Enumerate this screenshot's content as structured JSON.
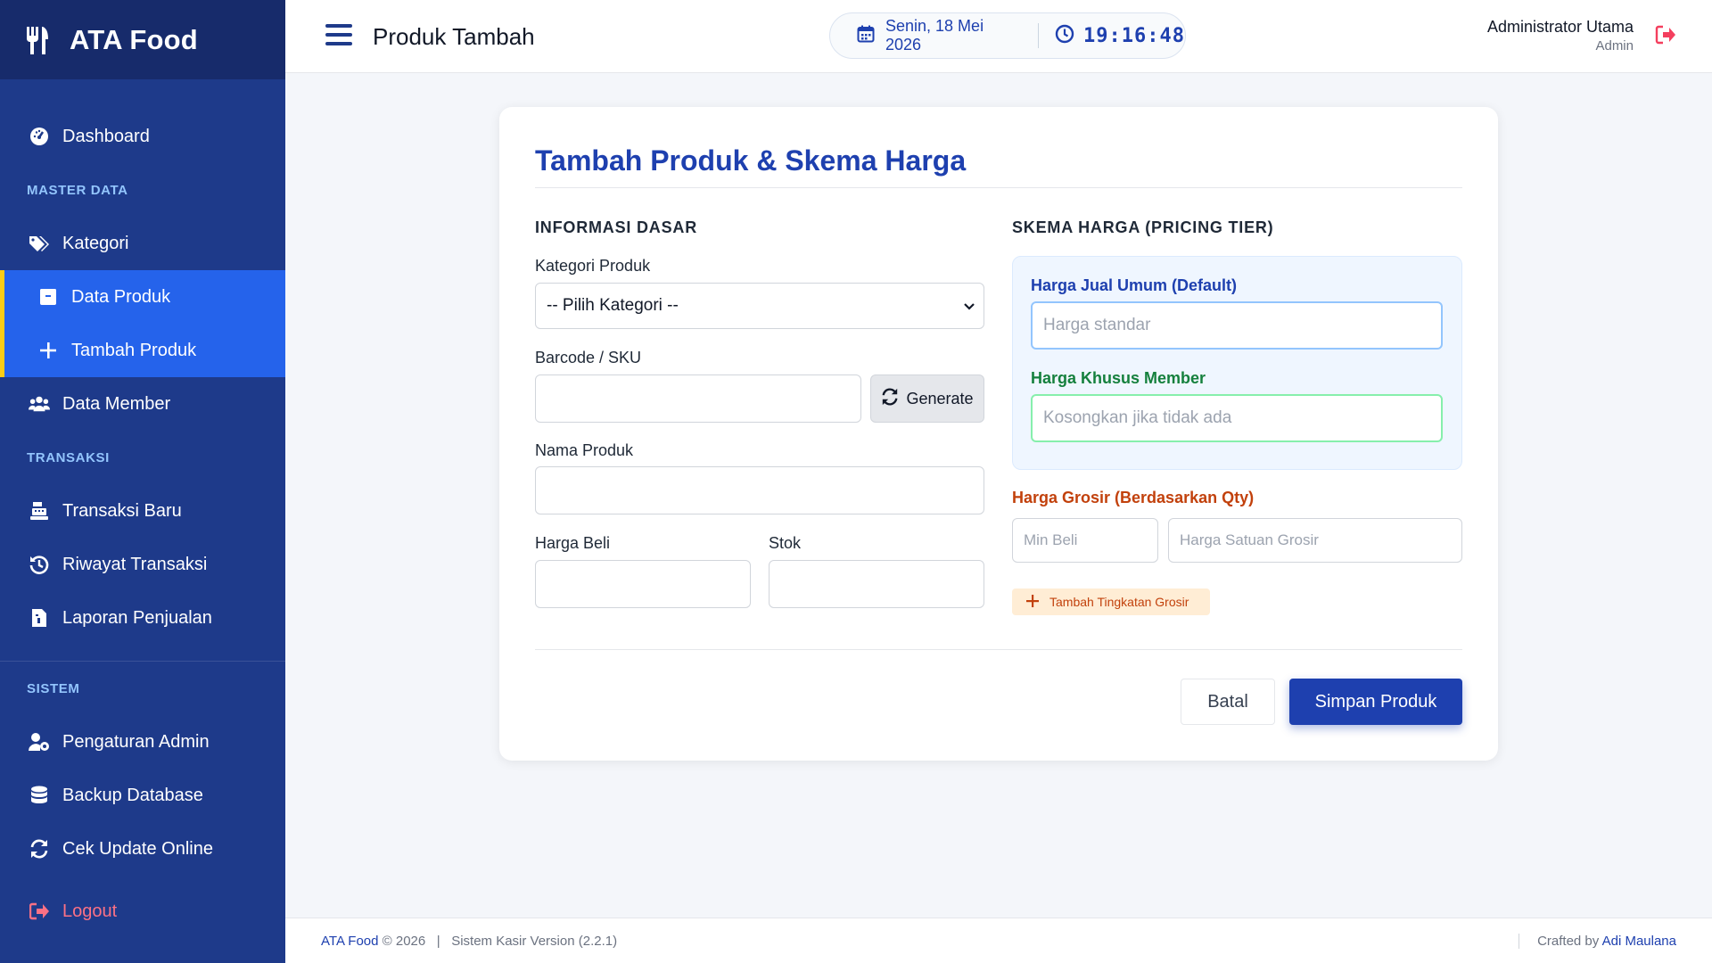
{
  "brand": {
    "name": "ATA Food",
    "icon": "utensils-icon"
  },
  "sidebar": {
    "dashboard": "Dashboard",
    "section_master": "MASTER DATA",
    "kategori": "Kategori",
    "data_produk": "Data Produk",
    "tambah_produk": "Tambah Produk",
    "data_member": "Data Member",
    "section_transaksi": "TRANSAKSI",
    "transaksi_baru": "Transaksi Baru",
    "riwayat_transaksi": "Riwayat Transaksi",
    "laporan_penjualan": "Laporan Penjualan",
    "section_sistem": "SISTEM",
    "pengaturan_admin": "Pengaturan Admin",
    "backup_database": "Backup Database",
    "cek_update": "Cek Update Online",
    "logout": "Logout"
  },
  "header": {
    "title": "Produk Tambah",
    "date": "Senin, 18 Mei 2026",
    "time": "19:16:48",
    "user_name": "Administrator Utama",
    "user_role": "Admin"
  },
  "form": {
    "title": "Tambah Produk & Skema Harga",
    "info_section": "INFORMASI DASAR",
    "kategori_label": "Kategori Produk",
    "kategori_selected": "-- Pilih Kategori --",
    "barcode_label": "Barcode / SKU",
    "barcode_value": "",
    "generate_label": "Generate",
    "nama_label": "Nama Produk",
    "nama_value": "",
    "harga_beli_label": "Harga Beli",
    "harga_beli_value": "",
    "stok_label": "Stok",
    "stok_value": "",
    "pricing_section": "SKEMA HARGA (PRICING TIER)",
    "harga_umum_label": "Harga Jual Umum (Default)",
    "harga_umum_placeholder": "Harga standar",
    "harga_member_label": "Harga Khusus Member",
    "harga_member_placeholder": "Kosongkan jika tidak ada",
    "grosir_label": "Harga Grosir (Berdasarkan Qty)",
    "min_beli_placeholder": "Min Beli",
    "harga_grosir_placeholder": "Harga Satuan Grosir",
    "tambah_tier_label": "Tambah Tingkatan Grosir",
    "batal_label": "Batal",
    "simpan_label": "Simpan Produk"
  },
  "footer": {
    "brand": "ATA Food",
    "copyright": "© 2026",
    "separator": "|",
    "version": "Sistem Kasir Version (2.2.1)",
    "crafted_prefix": "Crafted by",
    "author": "Adi Maulana"
  },
  "colors": {
    "sidebar": "#1e3a8a",
    "brand_bar": "#172b6b",
    "active_item": "#2563eb",
    "active_border": "#facc15",
    "primary": "#1e40af",
    "member_green": "#15803d",
    "grosir_orange": "#c2410c",
    "logout_red": "#fb7185"
  }
}
